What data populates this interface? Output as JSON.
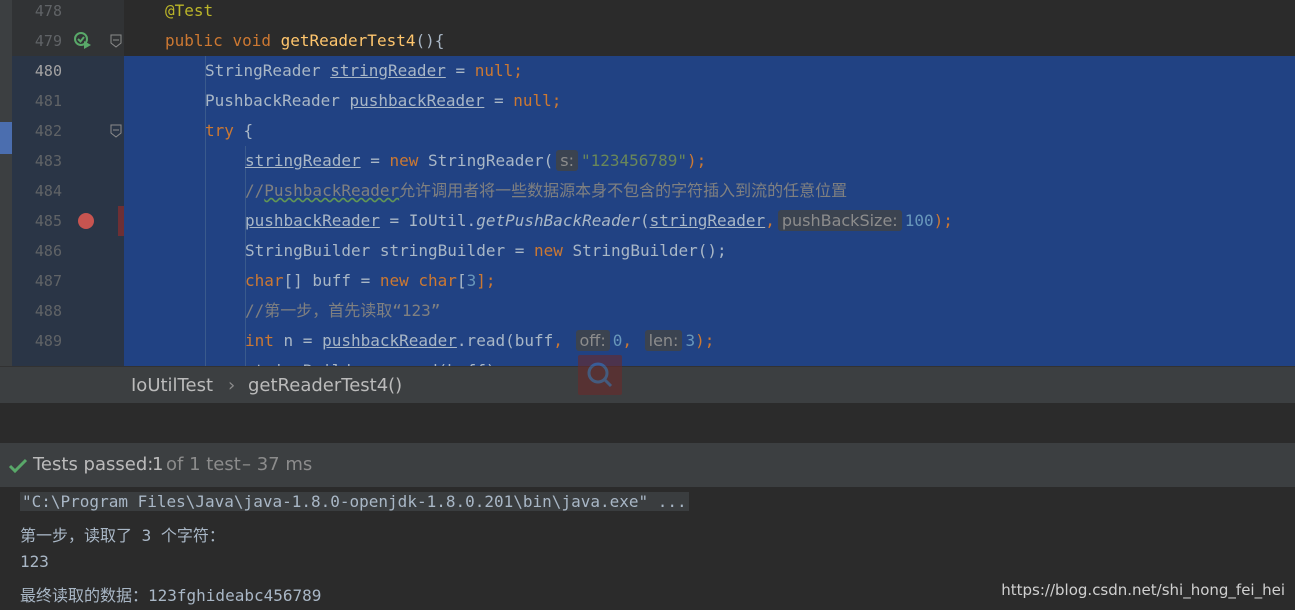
{
  "editor": {
    "lines": [
      {
        "number": "478",
        "tokens": [
          {
            "t": "@Test",
            "c": "ann"
          }
        ]
      },
      {
        "number": "479",
        "tokens": [
          {
            "t": "public ",
            "c": "kw"
          },
          {
            "t": "void ",
            "c": "kw"
          },
          {
            "t": "getReaderTest4",
            "c": "fn"
          },
          {
            "t": "(){",
            "c": ""
          }
        ]
      },
      {
        "number": "480",
        "tokens": [
          {
            "t": "StringReader ",
            "c": ""
          },
          {
            "t": "stringReader",
            "c": "u"
          },
          {
            "t": " = ",
            "c": ""
          },
          {
            "t": "null",
            "c": "kw"
          },
          {
            "t": ";",
            "c": "kw"
          }
        ]
      },
      {
        "number": "481",
        "tokens": [
          {
            "t": "PushbackReader ",
            "c": ""
          },
          {
            "t": "pushbackReader",
            "c": "u"
          },
          {
            "t": " = ",
            "c": ""
          },
          {
            "t": "null",
            "c": "kw"
          },
          {
            "t": ";",
            "c": "kw"
          }
        ]
      },
      {
        "number": "482",
        "tokens": [
          {
            "t": "try",
            "c": "kw"
          },
          {
            "t": " {",
            "c": ""
          }
        ]
      },
      {
        "number": "483",
        "tokens": [
          {
            "t": "stringReader",
            "c": "u"
          },
          {
            "t": " = ",
            "c": ""
          },
          {
            "t": "new ",
            "c": "kw"
          },
          {
            "t": "StringReader(",
            "c": ""
          },
          {
            "t": "s:",
            "c": "hint"
          },
          {
            "t": "\"123456789\"",
            "c": "str"
          },
          {
            "t": ");",
            "c": "kw"
          }
        ]
      },
      {
        "number": "484",
        "tokens": [
          {
            "t": "//",
            "c": "cmt"
          },
          {
            "t": "PushbackReader",
            "c": "cmt ucmt"
          },
          {
            "t": "允许调用者将一些数据源本身不包含的字符插入到流的任意位置",
            "c": "cmt"
          }
        ]
      },
      {
        "number": "485",
        "tokens": [
          {
            "t": "pushbackReader",
            "c": "u"
          },
          {
            "t": " = IoUtil.",
            "c": ""
          },
          {
            "t": "getPushBackReader",
            "c": "it"
          },
          {
            "t": "(",
            "c": ""
          },
          {
            "t": "stringReader",
            "c": "u"
          },
          {
            "t": ",",
            "c": "kw"
          },
          {
            "t": "pushBackSize:",
            "c": "hint"
          },
          {
            "t": "100",
            "c": "num"
          },
          {
            "t": ");",
            "c": "kw"
          }
        ]
      },
      {
        "number": "486",
        "tokens": [
          {
            "t": "StringBuilder stringBuilder = ",
            "c": ""
          },
          {
            "t": "new ",
            "c": "kw"
          },
          {
            "t": "StringBuilder();",
            "c": ""
          }
        ]
      },
      {
        "number": "487",
        "tokens": [
          {
            "t": "char",
            "c": "kw"
          },
          {
            "t": "[] buff = ",
            "c": ""
          },
          {
            "t": "new ",
            "c": "kw"
          },
          {
            "t": "char",
            "c": "kw"
          },
          {
            "t": "[",
            "c": ""
          },
          {
            "t": "3",
            "c": "num"
          },
          {
            "t": "];",
            "c": "kw"
          }
        ]
      },
      {
        "number": "488",
        "tokens": [
          {
            "t": "//第一步，首先读取“123”",
            "c": "cmt"
          }
        ]
      },
      {
        "number": "489",
        "tokens": [
          {
            "t": "int ",
            "c": "kw"
          },
          {
            "t": "n = ",
            "c": ""
          },
          {
            "t": "pushbackReader",
            "c": "u"
          },
          {
            "t": ".read(buff",
            "c": ""
          },
          {
            "t": ", ",
            "c": "kw"
          },
          {
            "t": "off:",
            "c": "hint"
          },
          {
            "t": "0",
            "c": "num"
          },
          {
            "t": ", ",
            "c": "kw"
          },
          {
            "t": "len:",
            "c": "hint"
          },
          {
            "t": "3",
            "c": "num"
          },
          {
            "t": ");",
            "c": "kw"
          }
        ]
      },
      {
        "number": "",
        "tokens": [
          {
            "t": "stringBuilder.append(buff);",
            "c": ""
          }
        ]
      }
    ]
  },
  "breadcrumb": {
    "class_name": "IoUtilTest",
    "separator": "›",
    "method_name": "getReaderTest4()"
  },
  "run": {
    "status_label": "Tests passed:",
    "passed_count": "1",
    "of_total": "of 1 test",
    "duration": "– 37 ms"
  },
  "console": {
    "command": "\"C:\\Program Files\\Java\\java-1.8.0-openjdk-1.8.0.201\\bin\\java.exe\" ...",
    "output_1": "第一步，读取了 3 个字符：",
    "output_2": "123",
    "output_3": "最终读取的数据：123fghideabc456789"
  },
  "watermark": "https://blog.csdn.net/shi_hong_fei_hei",
  "colors": {
    "selection": "#214283",
    "keyword": "#cc7832",
    "annotation": "#bbb529",
    "method": "#ffc66d",
    "string": "#6a8759",
    "number": "#6897bb",
    "comment": "#808080",
    "success": "#59a869"
  },
  "icons": [
    "run-test-icon",
    "fold-icon",
    "breakpoint-icon",
    "search-icon",
    "check-icon"
  ]
}
